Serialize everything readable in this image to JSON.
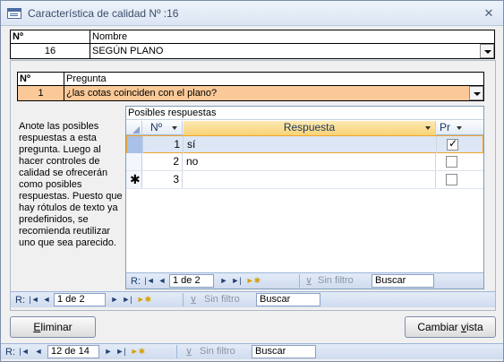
{
  "window": {
    "title": "Característica de calidad Nº :16",
    "close_glyph": "✕"
  },
  "caracteristica": {
    "num_label": "Nº Característica",
    "num_value": "16",
    "name_label": "Nombre",
    "name_value": "SEGÚN PLANO"
  },
  "pregunta": {
    "num_label": "Nº",
    "num_value": "1",
    "question_label": "Pregunta",
    "question_value": "¿las cotas coinciden con el plano?"
  },
  "help_text": "Anote las posibles respuestas a esta pregunta. Luego al hacer controles de calidad se ofrecerán como posibles respuestas. Puesto que hay rótulos de texto ya predefinidos, se recomienda reutilizar uno que sea parecido.",
  "subform": {
    "caption": "Posibles respuestas",
    "columns": [
      "Nº",
      "Respuesta",
      "Pr"
    ],
    "rows": [
      {
        "num": "1",
        "respuesta": "sí",
        "checked": true
      },
      {
        "num": "2",
        "respuesta": "no",
        "checked": false
      },
      {
        "num": "3",
        "respuesta": "",
        "checked": false
      }
    ],
    "new_row_glyph": "✱"
  },
  "nav_inner": {
    "record_label": "R:",
    "record_value": "1 de 2",
    "filter_label": "Sin filtro",
    "search_placeholder": "Buscar"
  },
  "nav_middle": {
    "record_label": "R:",
    "record_value": "1 de 2",
    "filter_label": "Sin filtro",
    "search_placeholder": "Buscar"
  },
  "nav_outer": {
    "record_label": "R:",
    "record_value": "12 de 14",
    "filter_label": "Sin filtro",
    "search_placeholder": "Buscar"
  },
  "buttons": {
    "delete_first": "E",
    "delete_rest": "liminar",
    "toggle_view_first": "Cambiar ",
    "toggle_view_mnemonic": "v",
    "toggle_view_rest": "ista"
  },
  "icons": {
    "nav_first": "|◄",
    "nav_prev": "◄",
    "nav_next": "►",
    "nav_last": "►|",
    "nav_new": "►✱",
    "nav_filter": "⊻",
    "dropdown": "chevron-down-icon"
  },
  "colors": {
    "selection_border": "#f2a52a",
    "header_accent": "#f8d377",
    "question_bg": "#fbc998"
  }
}
